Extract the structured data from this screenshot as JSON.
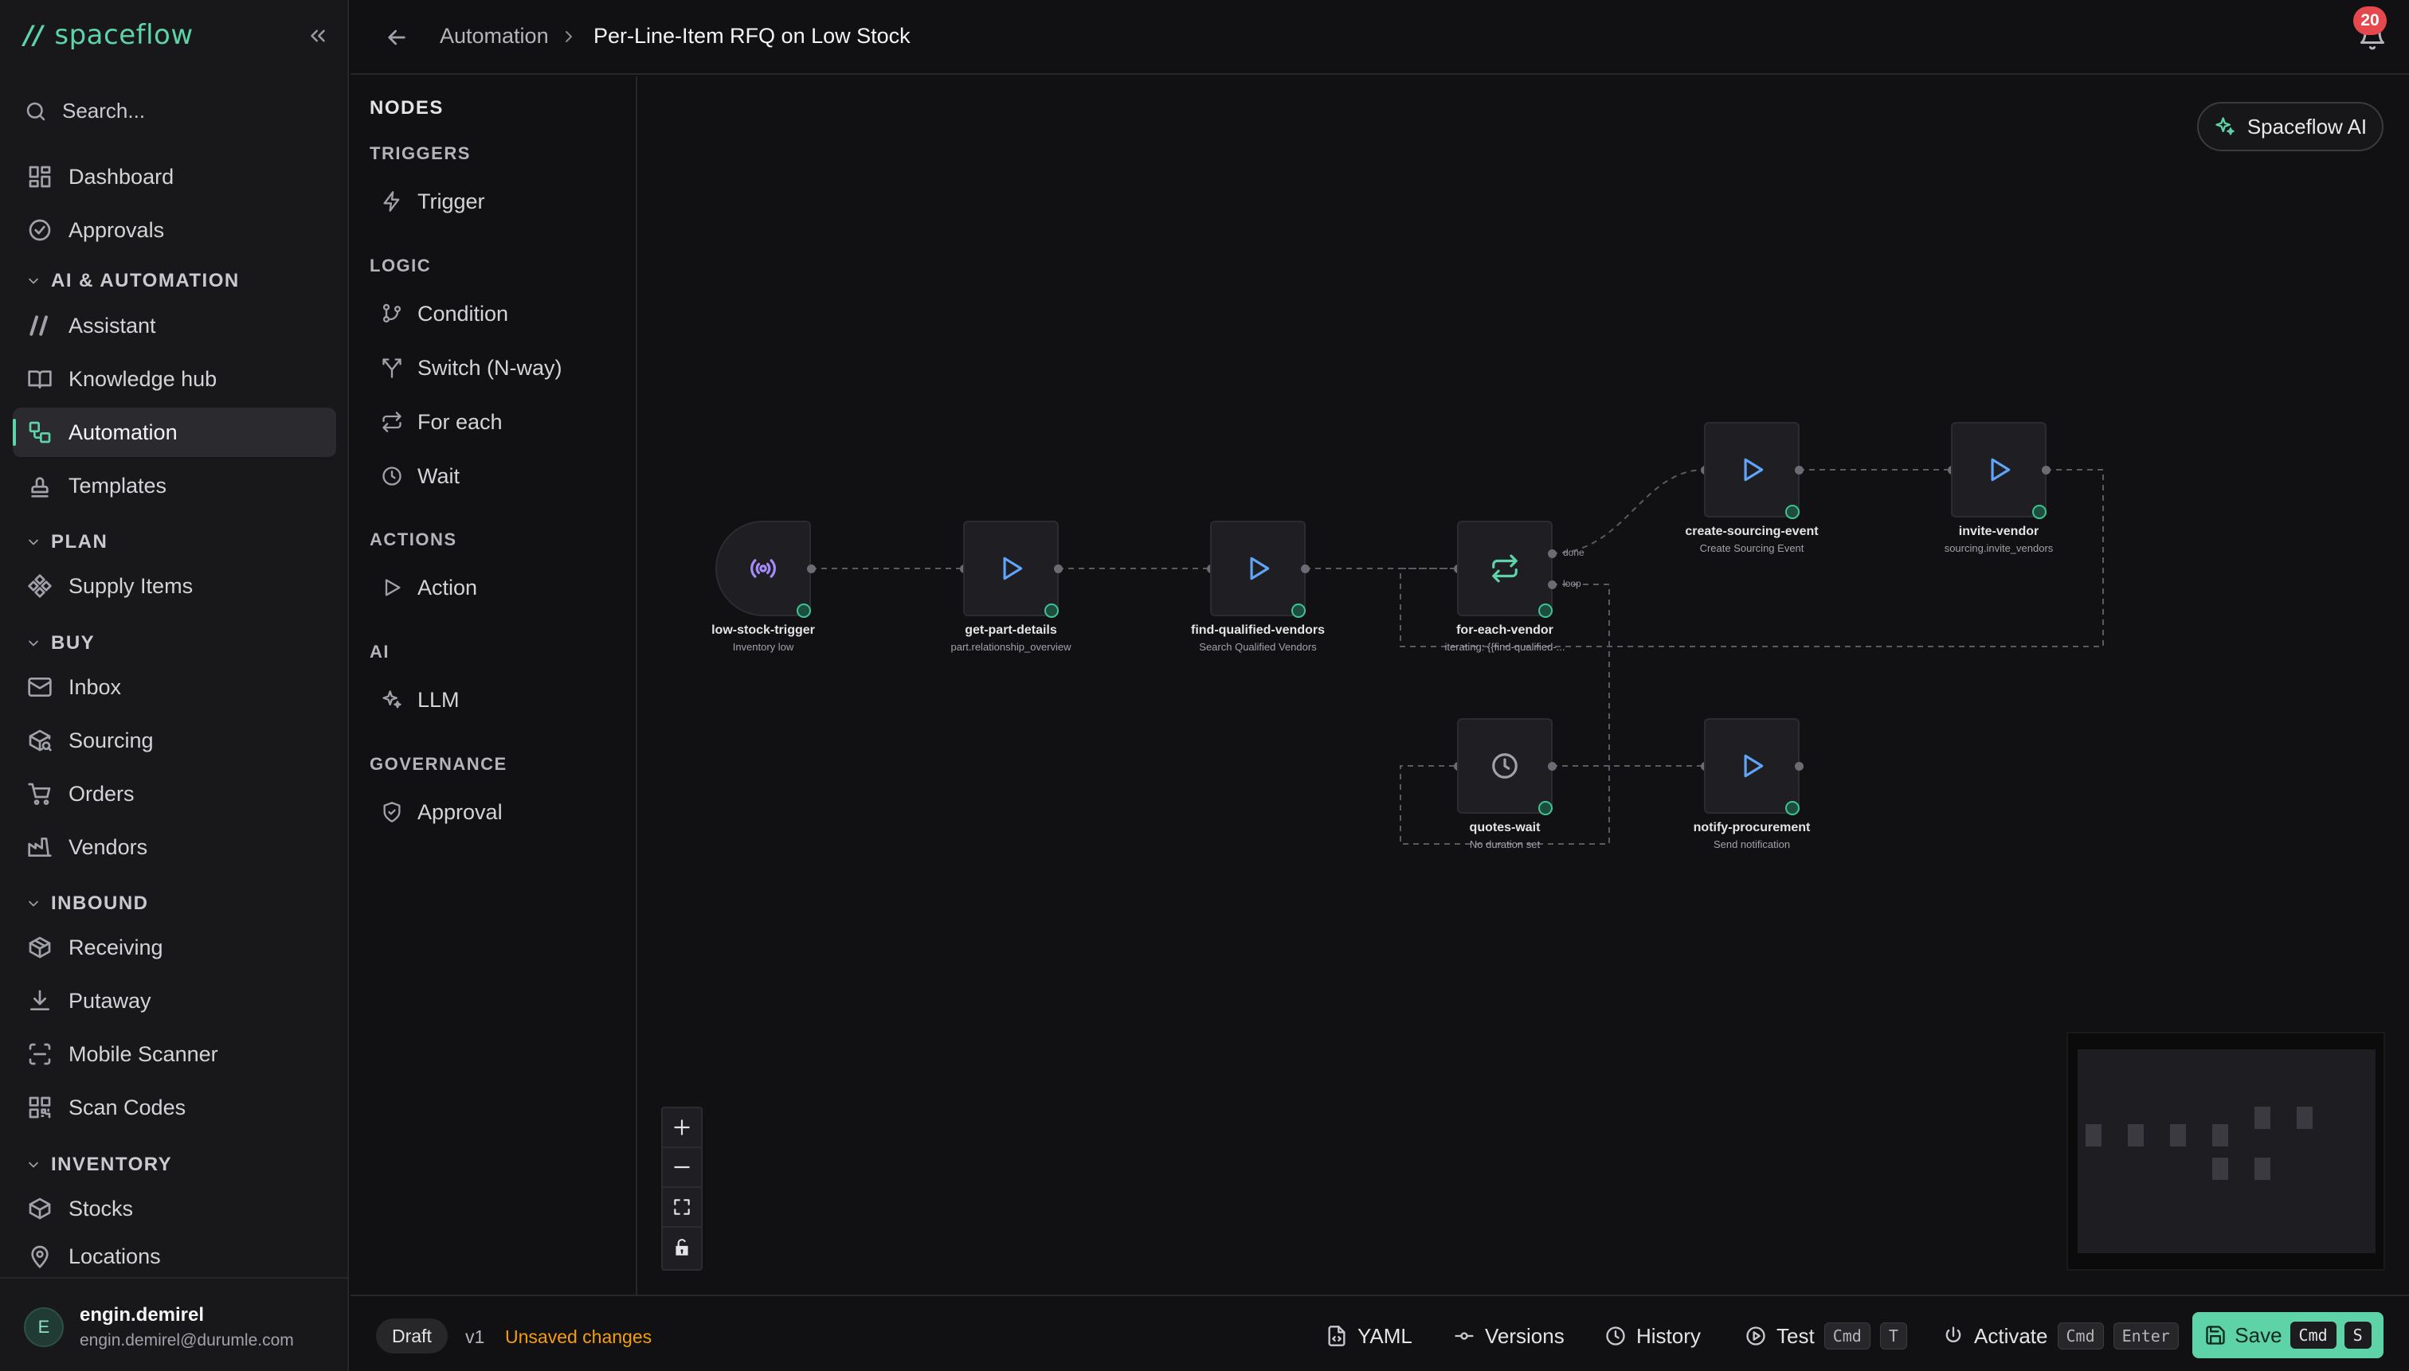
{
  "brand": {
    "name": "spaceflow",
    "mark": "//",
    "accent": "#5fd3a8"
  },
  "sidebar": {
    "search_label": "Search...",
    "items": [
      {
        "label": "Dashboard",
        "icon": "dashboard-icon"
      },
      {
        "label": "Approvals",
        "icon": "check-circle-icon"
      },
      {
        "label": "Assistant",
        "icon": "slashes-icon"
      },
      {
        "label": "Knowledge hub",
        "icon": "book-icon"
      },
      {
        "label": "Automation",
        "icon": "workflow-icon",
        "active": true
      },
      {
        "label": "Templates",
        "icon": "stamp-icon"
      },
      {
        "label": "Supply Items",
        "icon": "components-icon"
      },
      {
        "label": "Inbox",
        "icon": "mail-icon"
      },
      {
        "label": "Sourcing",
        "icon": "package-search-icon"
      },
      {
        "label": "Orders",
        "icon": "cart-icon"
      },
      {
        "label": "Vendors",
        "icon": "factory-icon"
      },
      {
        "label": "Receiving",
        "icon": "box-icon"
      },
      {
        "label": "Putaway",
        "icon": "download-icon"
      },
      {
        "label": "Mobile Scanner",
        "icon": "scan-icon"
      },
      {
        "label": "Scan Codes",
        "icon": "qr-icon"
      },
      {
        "label": "Stocks",
        "icon": "boxes-icon"
      },
      {
        "label": "Locations",
        "icon": "map-pin-icon"
      }
    ],
    "groups": [
      "AI & AUTOMATION",
      "PLAN",
      "BUY",
      "INBOUND",
      "INVENTORY"
    ],
    "user": {
      "initial": "E",
      "name": "engin.demirel",
      "email": "engin.demirel@durumle.com"
    }
  },
  "header": {
    "breadcrumb_parent": "Automation",
    "title": "Per-Line-Item RFQ on Low Stock",
    "notification_count": "20"
  },
  "palette": {
    "title": "NODES",
    "groups": [
      {
        "label": "TRIGGERS",
        "items": [
          "Trigger"
        ]
      },
      {
        "label": "LOGIC",
        "items": [
          "Condition",
          "Switch (N-way)",
          "For each",
          "Wait"
        ]
      },
      {
        "label": "ACTIONS",
        "items": [
          "Action"
        ]
      },
      {
        "label": "AI",
        "items": [
          "LLM"
        ]
      },
      {
        "label": "GOVERNANCE",
        "items": [
          "Approval"
        ]
      }
    ]
  },
  "canvas": {
    "ai_button": "Spaceflow AI",
    "nodes": [
      {
        "id": "low-stock-trigger",
        "sub": "Inventory low",
        "kind": "trigger"
      },
      {
        "id": "get-part-details",
        "sub": "part.relationship_overview",
        "kind": "action"
      },
      {
        "id": "find-qualified-vendors",
        "sub": "Search Qualified Vendors",
        "kind": "action"
      },
      {
        "id": "for-each-vendor",
        "sub": "iterating: {{find-qualified-...",
        "kind": "loop"
      },
      {
        "id": "create-sourcing-event",
        "sub": "Create Sourcing Event",
        "kind": "action"
      },
      {
        "id": "invite-vendor",
        "sub": "sourcing.invite_vendors",
        "kind": "action"
      },
      {
        "id": "quotes-wait",
        "sub": "No duration set",
        "kind": "wait"
      },
      {
        "id": "notify-procurement",
        "sub": "Send notification",
        "kind": "action"
      }
    ],
    "port_labels": {
      "done": "done",
      "loop": "loop"
    }
  },
  "footer": {
    "status": "Draft",
    "version": "v1",
    "unsaved": "Unsaved changes",
    "yaml": "YAML",
    "versions": "Versions",
    "history": "History",
    "test": "Test",
    "test_keys": [
      "Cmd",
      "T"
    ],
    "activate": "Activate",
    "activate_keys": [
      "Cmd",
      "Enter"
    ],
    "save": "Save",
    "save_keys": [
      "Cmd",
      "S"
    ]
  }
}
